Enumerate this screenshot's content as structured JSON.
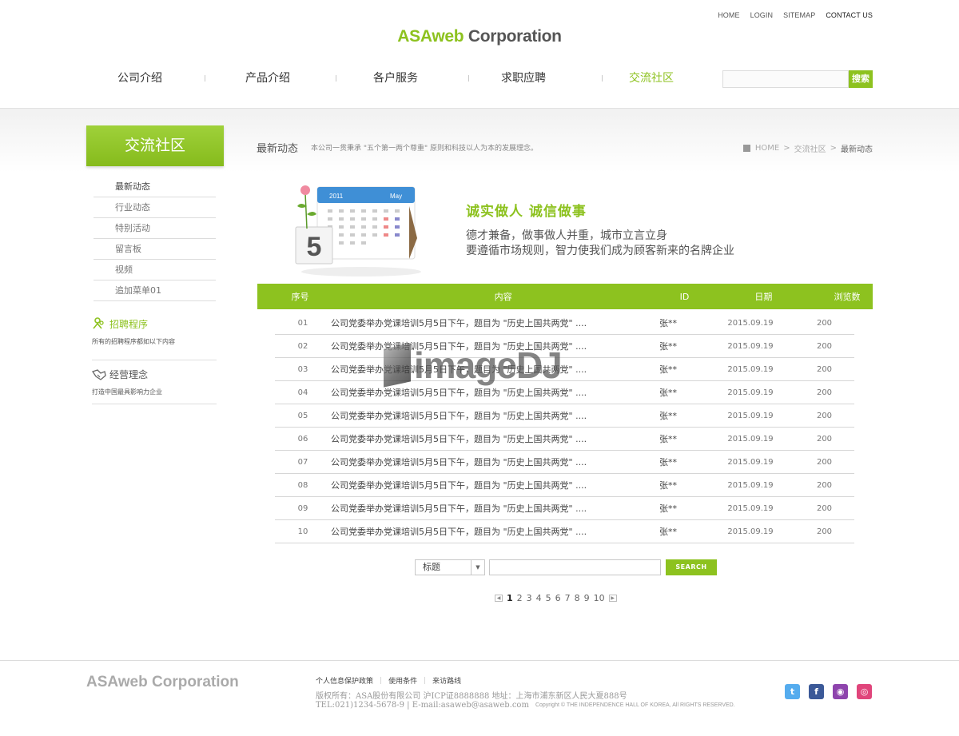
{
  "top_links": [
    "HOME",
    "LOGIN",
    "SITEMAP",
    "CONTACT US"
  ],
  "logo": {
    "brand": "ASAweb",
    "suffix": " Corporation"
  },
  "gnb": [
    "公司介绍",
    "产品介绍",
    "各户服务",
    "求职应聘",
    "交流社区"
  ],
  "top_search": {
    "button": "搜索"
  },
  "lnb": {
    "title": "交流社区",
    "menu": [
      "最新动态",
      "行业动态",
      "特别活动",
      "留言板",
      "视频",
      "追加菜单01"
    ]
  },
  "promos": [
    {
      "title": "招聘程序",
      "desc": "所有的招聘程序都如以下内容"
    },
    {
      "title": "经营理念",
      "desc": "打造中国最具影响力企业"
    }
  ],
  "page": {
    "title": "最新动态",
    "desc": "本公司一贯秉承 \"五个第一两个尊重\" 原则和科技以人为本的发展理念。",
    "breadcrumb": [
      "HOME",
      "交流社区",
      "最新动态"
    ]
  },
  "calendar": {
    "year": "2011",
    "month": "May",
    "day": "5"
  },
  "slogan": {
    "heading": "诚实做人  诚信做事",
    "line1": "德才兼备，做事做人并重，城市立言立身",
    "line2": "要遵循市场规则，智力使我们成为顾客新来的名牌企业"
  },
  "table": {
    "headers": [
      "序号",
      "内容",
      "ID",
      "日期",
      "浏览数"
    ],
    "rows": [
      {
        "no": "01",
        "title": "公司党委举办党课培训5月5日下午，题目为 \"历史上国共两党\" ....",
        "id": "张**",
        "date": "2015.09.19",
        "views": "200"
      },
      {
        "no": "02",
        "title": "公司党委举办党课培训5月5日下午，题目为 \"历史上国共两党\" ....",
        "id": "张**",
        "date": "2015.09.19",
        "views": "200"
      },
      {
        "no": "03",
        "title": "公司党委举办党课培训5月5日下午，题目为 \"历史上国共两党\" ....",
        "id": "张**",
        "date": "2015.09.19",
        "views": "200"
      },
      {
        "no": "04",
        "title": "公司党委举办党课培训5月5日下午，题目为 \"历史上国共两党\" ....",
        "id": "张**",
        "date": "2015.09.19",
        "views": "200"
      },
      {
        "no": "05",
        "title": "公司党委举办党课培训5月5日下午，题目为 \"历史上国共两党\" ....",
        "id": "张**",
        "date": "2015.09.19",
        "views": "200"
      },
      {
        "no": "06",
        "title": "公司党委举办党课培训5月5日下午，题目为 \"历史上国共两党\" ....",
        "id": "张**",
        "date": "2015.09.19",
        "views": "200"
      },
      {
        "no": "07",
        "title": "公司党委举办党课培训5月5日下午，题目为 \"历史上国共两党\" ....",
        "id": "张**",
        "date": "2015.09.19",
        "views": "200"
      },
      {
        "no": "08",
        "title": "公司党委举办党课培训5月5日下午，题目为 \"历史上国共两党\" ....",
        "id": "张**",
        "date": "2015.09.19",
        "views": "200"
      },
      {
        "no": "09",
        "title": "公司党委举办党课培训5月5日下午，题目为 \"历史上国共两党\" ....",
        "id": "张**",
        "date": "2015.09.19",
        "views": "200"
      },
      {
        "no": "10",
        "title": "公司党委举办党课培训5月5日下午，题目为 \"历史上国共两党\" ....",
        "id": "张**",
        "date": "2015.09.19",
        "views": "200"
      }
    ]
  },
  "search": {
    "select_value": "标题",
    "button": "SEARCH"
  },
  "paging": {
    "pages": [
      "1",
      "2",
      "3",
      "4",
      "5",
      "6",
      "7",
      "8",
      "9",
      "10"
    ],
    "current": "1"
  },
  "watermark": "imageDJ",
  "footer": {
    "logo": "ASAweb Corporation",
    "links": [
      "个人信息保护政策",
      "使用条件",
      "来访路线"
    ],
    "addr1": "版权所有：ASA股份有限公司  沪ICP证8888888  地址：上海市浦东新区人民大夏888号",
    "tel": "TEL:021)1234-5678-9  |  E-mail:asaweb@asaweb.com",
    "copyright": "Copyright © THE INDEPENDENCE HALL OF KOREA, All RIGHTS RESERVED."
  },
  "social": [
    {
      "icon": "twitter-icon",
      "glyph": "t",
      "color": "#55acee"
    },
    {
      "icon": "facebook-icon",
      "glyph": "f",
      "color": "#3b5998"
    },
    {
      "icon": "pin-icon",
      "glyph": "◉",
      "color": "#8e44ad"
    },
    {
      "icon": "instagram-icon",
      "glyph": "◎",
      "color": "#e0457b"
    }
  ],
  "colors": {
    "accent": "#8dc21f"
  }
}
